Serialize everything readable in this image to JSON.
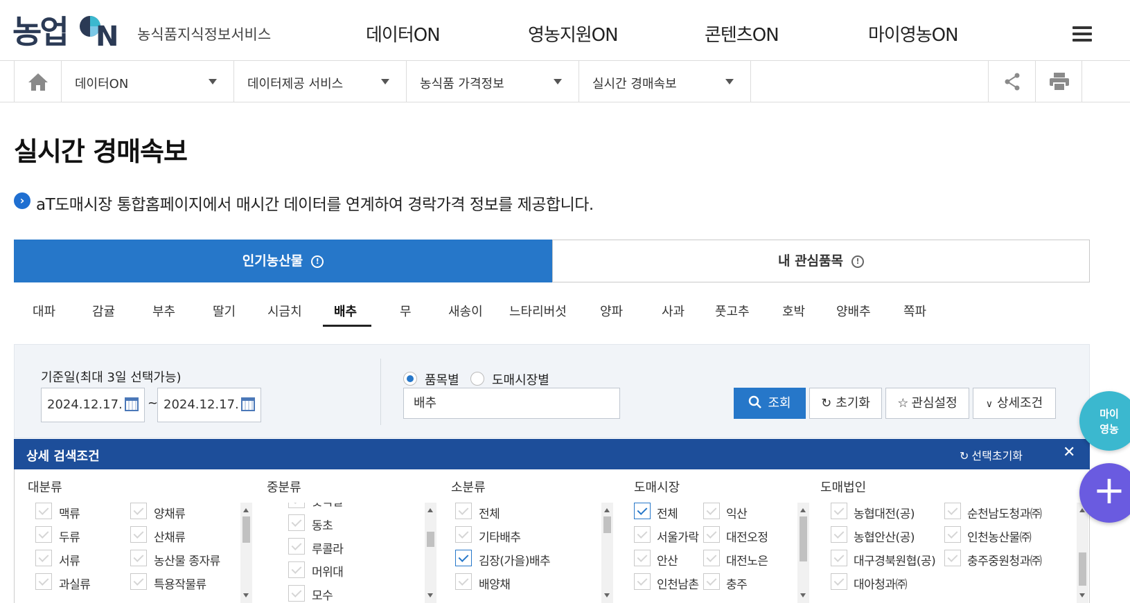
{
  "header": {
    "logo_text": "농업ON",
    "logo_sub": "농식품지식정보서비스",
    "nav": [
      "데이터ON",
      "영농지원ON",
      "콘텐츠ON",
      "마이영농ON"
    ]
  },
  "breadcrumb": [
    "데이터ON",
    "데이터제공 서비스",
    "농식품 가격정보",
    "실시간 경매속보"
  ],
  "page": {
    "title": "실시간 경매속보",
    "info": "aT도매시장 통합홈페이지에서 매시간 데이터를 연계하여 경락가격 정보를 제공합니다."
  },
  "tabs": {
    "popular": "인기농산물",
    "interest": "내 관심품목"
  },
  "categories": [
    "대파",
    "감귤",
    "부추",
    "딸기",
    "시금치",
    "배추",
    "무",
    "새송이",
    "느타리버섯",
    "양파",
    "사과",
    "풋고추",
    "호박",
    "양배추",
    "쪽파"
  ],
  "selected_category": "배추",
  "search": {
    "date_label": "기준일(최대 3일 선택가능)",
    "date_from": "2024.12.17.",
    "date_sep": "~",
    "date_to": "2024.12.17.",
    "radio_item": "품목별",
    "radio_market": "도매시장별",
    "item_value": "배추",
    "btn_search": "조회",
    "btn_reset": "초기화",
    "btn_interest": "관심설정",
    "btn_detail": "상세조건"
  },
  "detail": {
    "title": "상세 검색조건",
    "reset": "선택초기화",
    "col_major": "대분류",
    "col_middle": "중분류",
    "col_minor": "소분류",
    "col_market": "도매시장",
    "col_corp": "도매법인",
    "major": [
      "맥류",
      "양채류",
      "두류",
      "산채류",
      "서류",
      "농산물 종자류",
      "과실류",
      "특용작물류"
    ],
    "middle": [
      "숫녹갈",
      "동초",
      "루콜라",
      "머위대",
      "모수"
    ],
    "minor": [
      "전체",
      "기타배추",
      "김장(가을)배추",
      "배양채"
    ],
    "market": [
      "전체",
      "익산",
      "서울가락",
      "대전오정",
      "안산",
      "대전노은",
      "인천남촌",
      "충주"
    ],
    "corp": [
      "농협대전(공)",
      "순천남도청과㈜",
      "농협안산(공)",
      "인천농산물㈜",
      "대구경북원협(공)",
      "충주중원청과㈜",
      "대아청과㈜"
    ]
  },
  "floats": {
    "my_line1": "마이",
    "my_line2": "영농",
    "plus": "+"
  },
  "colors": {
    "primary": "#2677c9",
    "detail_head": "#1d4e9a",
    "float_my": "#3bb8cf",
    "float_plus": "#6a5be0"
  }
}
